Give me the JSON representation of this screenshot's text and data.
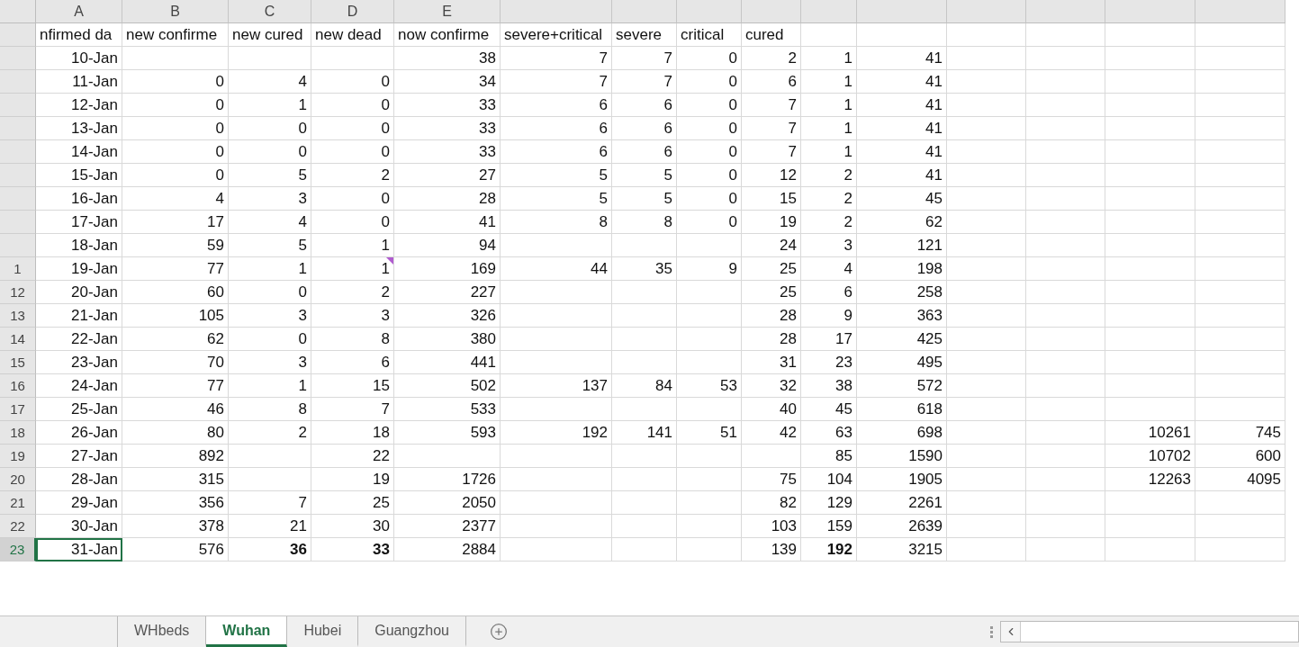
{
  "column_letters": [
    "A",
    "B",
    "C",
    "D",
    "E"
  ],
  "header_row": [
    "nfirmed da",
    "new confirme",
    "new cured",
    "new dead",
    "now confirme",
    "severe+critical",
    "severe",
    "critical",
    "cured"
  ],
  "rows": [
    {
      "selected": false,
      "cells": [
        "10-Jan",
        null,
        null,
        null,
        "38",
        "7",
        "7",
        "0",
        "2",
        "1",
        "41",
        null,
        null,
        null,
        null
      ]
    },
    {
      "selected": false,
      "cells": [
        "11-Jan",
        "0",
        "4",
        "0",
        "34",
        "7",
        "7",
        "0",
        "6",
        "1",
        "41",
        null,
        null,
        null,
        null
      ]
    },
    {
      "selected": false,
      "cells": [
        "12-Jan",
        "0",
        "1",
        "0",
        "33",
        "6",
        "6",
        "0",
        "7",
        "1",
        "41",
        null,
        null,
        null,
        null
      ]
    },
    {
      "selected": false,
      "cells": [
        "13-Jan",
        "0",
        "0",
        "0",
        "33",
        "6",
        "6",
        "0",
        "7",
        "1",
        "41",
        null,
        null,
        null,
        null
      ]
    },
    {
      "selected": false,
      "cells": [
        "14-Jan",
        "0",
        "0",
        "0",
        "33",
        "6",
        "6",
        "0",
        "7",
        "1",
        "41",
        null,
        null,
        null,
        null
      ]
    },
    {
      "selected": false,
      "cells": [
        "15-Jan",
        "0",
        "5",
        "2",
        "27",
        "5",
        "5",
        "0",
        "12",
        "2",
        "41",
        null,
        null,
        null,
        null
      ]
    },
    {
      "selected": false,
      "cells": [
        "16-Jan",
        "4",
        "3",
        "0",
        "28",
        "5",
        "5",
        "0",
        "15",
        "2",
        "45",
        null,
        null,
        null,
        null
      ]
    },
    {
      "selected": false,
      "cells": [
        "17-Jan",
        "17",
        "4",
        "0",
        "41",
        "8",
        "8",
        "0",
        "19",
        "2",
        "62",
        null,
        null,
        null,
        null
      ]
    },
    {
      "selected": false,
      "cells": [
        "18-Jan",
        "59",
        "5",
        "1",
        "94",
        null,
        null,
        null,
        "24",
        "3",
        "121",
        null,
        null,
        null,
        null
      ]
    },
    {
      "number": "1",
      "selected": false,
      "cells": [
        "19-Jan",
        "77",
        "1",
        {
          "text": "1",
          "comment": true
        },
        "169",
        "44",
        "35",
        "9",
        "25",
        "4",
        "198",
        null,
        null,
        null,
        null
      ]
    },
    {
      "number": "12",
      "selected": false,
      "cells": [
        "20-Jan",
        "60",
        "0",
        "2",
        "227",
        null,
        null,
        null,
        "25",
        "6",
        "258",
        null,
        null,
        null,
        null
      ]
    },
    {
      "number": "13",
      "selected": false,
      "cells": [
        "21-Jan",
        "105",
        "3",
        "3",
        "326",
        null,
        null,
        null,
        "28",
        "9",
        "363",
        null,
        null,
        null,
        null
      ]
    },
    {
      "number": "14",
      "selected": false,
      "cells": [
        "22-Jan",
        "62",
        "0",
        "8",
        "380",
        null,
        null,
        null,
        "28",
        "17",
        "425",
        null,
        null,
        null,
        null
      ]
    },
    {
      "number": "15",
      "selected": false,
      "cells": [
        "23-Jan",
        "70",
        "3",
        "6",
        "441",
        null,
        null,
        null,
        "31",
        "23",
        "495",
        null,
        null,
        null,
        null
      ]
    },
    {
      "number": "16",
      "selected": false,
      "cells": [
        "24-Jan",
        "77",
        "1",
        "15",
        "502",
        "137",
        "84",
        "53",
        "32",
        "38",
        "572",
        null,
        null,
        null,
        null
      ]
    },
    {
      "number": "17",
      "selected": false,
      "cells": [
        "25-Jan",
        "46",
        "8",
        "7",
        "533",
        null,
        null,
        null,
        "40",
        "45",
        "618",
        null,
        null,
        null,
        null
      ]
    },
    {
      "number": "18",
      "selected": false,
      "cells": [
        "26-Jan",
        "80",
        "2",
        "18",
        "593",
        "192",
        "141",
        "51",
        "42",
        "63",
        "698",
        null,
        null,
        "10261",
        "745"
      ]
    },
    {
      "number": "19",
      "selected": false,
      "cells": [
        "27-Jan",
        "892",
        null,
        "22",
        null,
        null,
        null,
        null,
        null,
        "85",
        "1590",
        null,
        null,
        "10702",
        "600"
      ]
    },
    {
      "number": "20",
      "selected": false,
      "cells": [
        "28-Jan",
        "315",
        null,
        "19",
        "1726",
        null,
        null,
        null,
        "75",
        "104",
        "1905",
        null,
        null,
        "12263",
        "4095"
      ]
    },
    {
      "number": "21",
      "selected": false,
      "cells": [
        "29-Jan",
        "356",
        "7",
        "25",
        "2050",
        null,
        null,
        null,
        "82",
        "129",
        "2261",
        null,
        null,
        null,
        null
      ]
    },
    {
      "number": "22",
      "selected": false,
      "cells": [
        "30-Jan",
        "378",
        "21",
        "30",
        "2377",
        null,
        null,
        null,
        "103",
        "159",
        "2639",
        null,
        null,
        null,
        null
      ]
    },
    {
      "number": "23",
      "selected": true,
      "cells": [
        "31-Jan",
        "576",
        {
          "text": "36",
          "bold": true
        },
        {
          "text": "33",
          "bold": true
        },
        "2884",
        null,
        null,
        null,
        "139",
        {
          "text": "192",
          "bold": true
        },
        "3215",
        null,
        null,
        null,
        null
      ]
    }
  ],
  "sheet_tabs": [
    {
      "label": "WHbeds",
      "selected": false
    },
    {
      "label": "Wuhan",
      "selected": true
    },
    {
      "label": "Hubei",
      "selected": false
    },
    {
      "label": "Guangzhou",
      "selected": false
    }
  ]
}
